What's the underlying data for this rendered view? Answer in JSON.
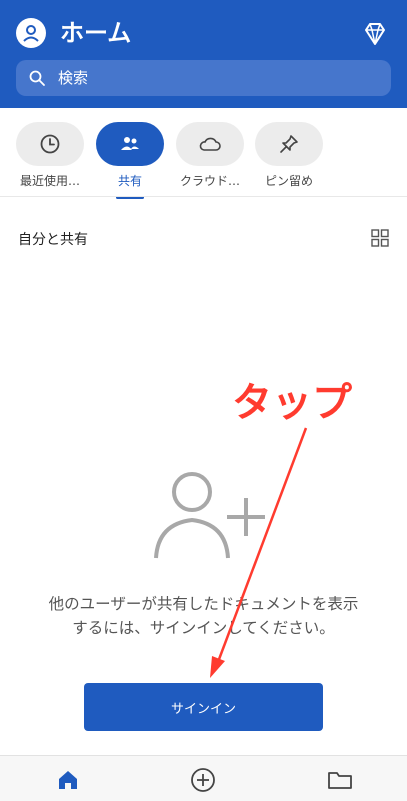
{
  "header": {
    "title": "ホーム",
    "search_placeholder": "検索",
    "accent": "#1f5bbf"
  },
  "tabs": [
    {
      "label": "最近使用…",
      "icon": "clock-icon",
      "active": false
    },
    {
      "label": "共有",
      "icon": "people-icon",
      "active": true
    },
    {
      "label": "クラウド…",
      "icon": "cloud-icon",
      "active": false
    },
    {
      "label": "ピン留め",
      "icon": "pin-icon",
      "active": false
    }
  ],
  "main": {
    "section_title": "自分と共有",
    "empty_message_line1": "他のユーザーが共有したドキュメントを表示",
    "empty_message_line2": "するには、サインインしてください。",
    "signin_label": "サインイン"
  },
  "annotation": {
    "text": "タップ",
    "color": "#ff3b2f"
  },
  "bottom_nav": [
    {
      "icon": "home-icon",
      "active": true
    },
    {
      "icon": "add-circle-icon",
      "active": false
    },
    {
      "icon": "folder-icon",
      "active": false
    }
  ]
}
